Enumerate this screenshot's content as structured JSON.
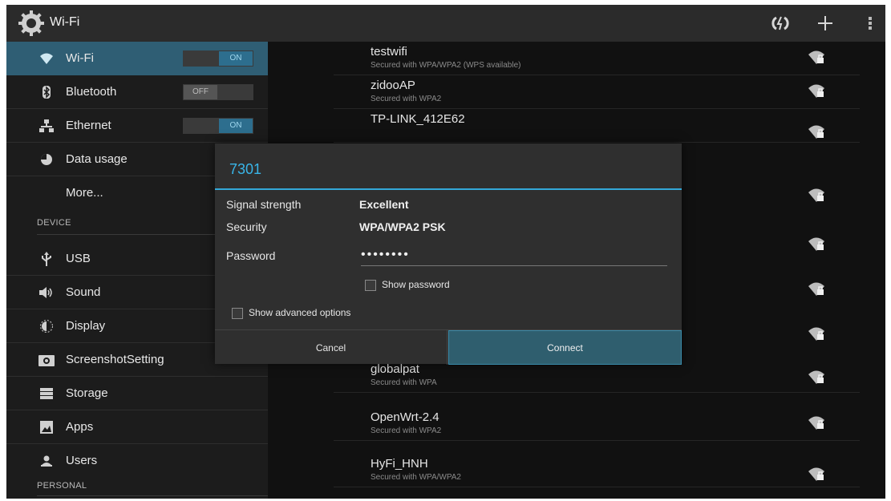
{
  "app": {
    "title": "Wi-Fi",
    "icon": "gear-icon"
  },
  "actionbar": {
    "actions": [
      "wps-icon",
      "add-icon",
      "overflow-menu-icon"
    ]
  },
  "sidebar": {
    "items": [
      {
        "label": "Wi-Fi",
        "icon": "wifi-icon",
        "toggle": "ON",
        "selected": true
      },
      {
        "label": "Bluetooth",
        "icon": "bluetooth-icon",
        "toggle": "OFF"
      },
      {
        "label": "Ethernet",
        "icon": "ethernet-icon",
        "toggle": "ON"
      },
      {
        "label": "Data usage",
        "icon": "data-usage-icon"
      },
      {
        "label": "More..."
      },
      {
        "label": "USB",
        "icon": "usb-icon"
      },
      {
        "label": "Sound",
        "icon": "sound-icon"
      },
      {
        "label": "Display",
        "icon": "display-icon"
      },
      {
        "label": "ScreenshotSetting",
        "icon": "camera-icon"
      },
      {
        "label": "Storage",
        "icon": "storage-icon"
      },
      {
        "label": "Apps",
        "icon": "apps-icon"
      },
      {
        "label": "Users",
        "icon": "users-icon"
      }
    ],
    "sections": {
      "device": "DEVICE",
      "personal": "PERSONAL"
    }
  },
  "networks": [
    {
      "ssid": "testwifi",
      "security": "Secured with WPA/WPA2 (WPS available)"
    },
    {
      "ssid": "zidooAP",
      "security": "Secured with WPA2"
    },
    {
      "ssid": "TP-LINK_412E62",
      "security": ""
    },
    {
      "ssid": "",
      "security": ""
    },
    {
      "ssid": "",
      "security": ""
    },
    {
      "ssid": "",
      "security": ""
    },
    {
      "ssid": "",
      "security": ""
    },
    {
      "ssid": "globalpat",
      "security": "Secured with WPA"
    },
    {
      "ssid": "OpenWrt-2.4",
      "security": "Secured with WPA2"
    },
    {
      "ssid": "HyFi_HNH",
      "security": "Secured with WPA/WPA2"
    },
    {
      "ssid": "",
      "security": ""
    }
  ],
  "dialog": {
    "title": "7301",
    "signal_label": "Signal strength",
    "signal_value": "Excellent",
    "security_label": "Security",
    "security_value": "WPA/WPA2 PSK",
    "password_label": "Password",
    "password_value": "••••••••",
    "show_password_label": "Show password",
    "show_advanced_label": "Show advanced options",
    "cancel_label": "Cancel",
    "connect_label": "Connect"
  },
  "colors": {
    "accent": "#33a8d8",
    "selected_row": "#2f5e74",
    "toggle_on": "#2d6e8e"
  }
}
